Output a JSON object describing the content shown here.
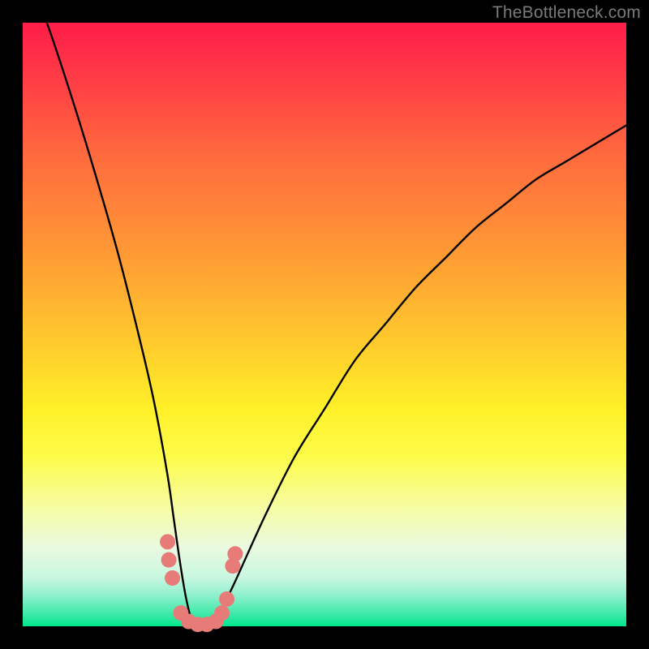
{
  "watermark": "TheBottleneck.com",
  "chart_data": {
    "type": "line",
    "title": "",
    "xlabel": "",
    "ylabel": "",
    "xlim": [
      0,
      100
    ],
    "ylim": [
      0,
      100
    ],
    "series": [
      {
        "name": "bottleneck-curve",
        "x": [
          0,
          4,
          8,
          12,
          16,
          20,
          22,
          24,
          25,
          26,
          27,
          28,
          29,
          30,
          31,
          32,
          33,
          35,
          40,
          45,
          50,
          55,
          60,
          65,
          70,
          75,
          80,
          85,
          90,
          95,
          100
        ],
        "y": [
          110,
          100,
          88,
          75,
          61,
          45,
          36,
          25,
          18,
          11,
          5,
          1,
          0,
          0,
          0,
          1,
          3,
          7,
          18,
          28,
          36,
          44,
          50,
          56,
          61,
          66,
          70,
          74,
          77,
          80,
          83
        ]
      }
    ],
    "markers": {
      "name": "highlight-dots",
      "color": "#e77b78",
      "points": [
        {
          "x": 24.0,
          "y": 14
        },
        {
          "x": 24.2,
          "y": 11
        },
        {
          "x": 24.8,
          "y": 8
        },
        {
          "x": 26.2,
          "y": 2.2
        },
        {
          "x": 27.5,
          "y": 0.8
        },
        {
          "x": 29.0,
          "y": 0.3
        },
        {
          "x": 30.5,
          "y": 0.3
        },
        {
          "x": 32.0,
          "y": 0.8
        },
        {
          "x": 33.0,
          "y": 2.2
        },
        {
          "x": 33.8,
          "y": 4.5
        },
        {
          "x": 34.8,
          "y": 10
        },
        {
          "x": 35.2,
          "y": 12
        }
      ]
    }
  }
}
